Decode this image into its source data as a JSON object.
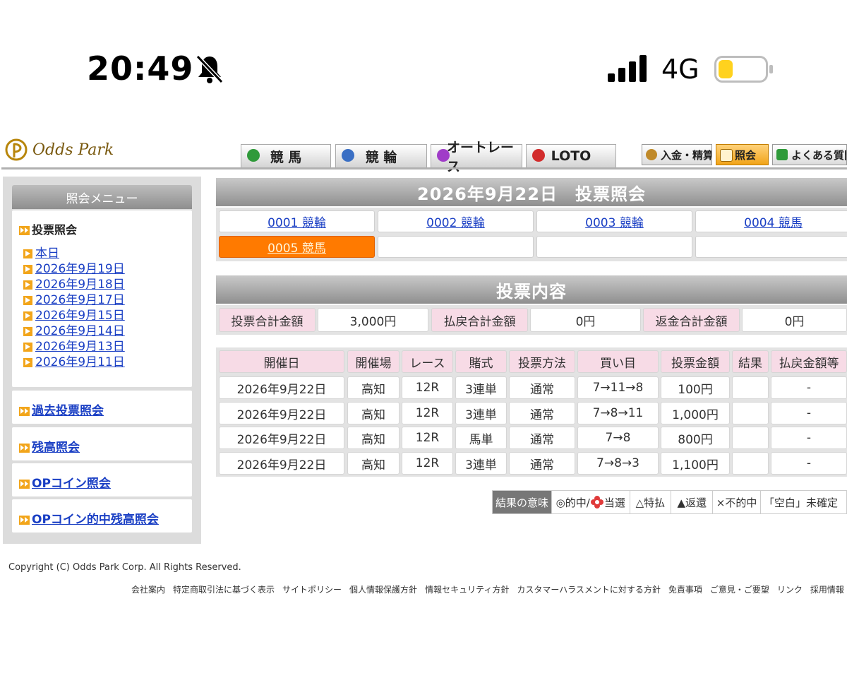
{
  "status_bar": {
    "time": "20:49",
    "network": "4G",
    "battery_level": 0.3
  },
  "header": {
    "logo_text": "Odds Park",
    "tabs": [
      {
        "label": "競 馬",
        "icon": "horse-icon",
        "color": "#2f9a3a"
      },
      {
        "label": "競 輪",
        "icon": "bicycle-icon",
        "color": "#3a6fc4"
      },
      {
        "label": "オートレース",
        "icon": "motorbike-icon",
        "color": "#a03cc8"
      },
      {
        "label": "LOTO",
        "icon": "loto-icon",
        "color": "#d22c2c"
      }
    ],
    "buttons": [
      {
        "label": "入金・精算",
        "icon": "money-bag-icon"
      },
      {
        "label": "照会",
        "icon": "book-icon"
      },
      {
        "label": "よくある質問",
        "icon": "help-icon"
      }
    ]
  },
  "sidebar": {
    "title": "照会メニュー",
    "vote_inquiry": "投票照会",
    "dates": [
      "本日",
      "2026年9月19日",
      "2026年9月18日",
      "2026年9月17日",
      "2026年9月15日",
      "2026年9月14日",
      "2026年9月13日",
      "2026年9月11日"
    ],
    "links": [
      "過去投票照会",
      "残高照会",
      "OPコイン照会",
      "OPコイン的中残高照会"
    ]
  },
  "main": {
    "title": "2026年9月22日　投票照会",
    "slots": [
      "0001 競輪",
      "0002 競輪",
      "0003 競輪",
      "0004 競馬",
      "0005 競馬",
      "",
      "",
      ""
    ],
    "content_title": "投票内容",
    "totals": [
      {
        "label": "投票合計金額",
        "value": "3,000円"
      },
      {
        "label": "払戻合計金額",
        "value": "0円"
      },
      {
        "label": "返金合計金額",
        "value": "0円"
      }
    ],
    "table": {
      "headers": [
        "開催日",
        "開催場",
        "レース",
        "賭式",
        "投票方法",
        "買い目",
        "投票金額",
        "結果",
        "払戻金額等"
      ],
      "rows": [
        [
          "2026年9月22日",
          "高知",
          "12R",
          "3連単",
          "通常",
          "7→11→8",
          "100円",
          "",
          "-"
        ],
        [
          "2026年9月22日",
          "高知",
          "12R",
          "3連単",
          "通常",
          "7→8→11",
          "1,000円",
          "",
          "-"
        ],
        [
          "2026年9月22日",
          "高知",
          "12R",
          "馬単",
          "通常",
          "7→8",
          "800円",
          "",
          "-"
        ],
        [
          "2026年9月22日",
          "高知",
          "12R",
          "3連単",
          "通常",
          "7→8→3",
          "1,100円",
          "",
          "-"
        ]
      ]
    },
    "legend": {
      "title": "結果の意味",
      "items": [
        "◎的中/",
        "当選",
        "△特払",
        "▲返還",
        "×不的中",
        "「空白」未確定"
      ]
    }
  },
  "footer": {
    "copyright": "Copyright (C) Odds Park Corp. All Rights Reserved.",
    "links": [
      "会社案内",
      "特定商取引法に基づく表示",
      "サイトポリシー",
      "個人情報保護方針",
      "情報セキュリティ方針",
      "カスタマーハラスメントに対する方針",
      "免責事項",
      "ご意見・ご要望",
      "リンク",
      "採用情報"
    ]
  }
}
